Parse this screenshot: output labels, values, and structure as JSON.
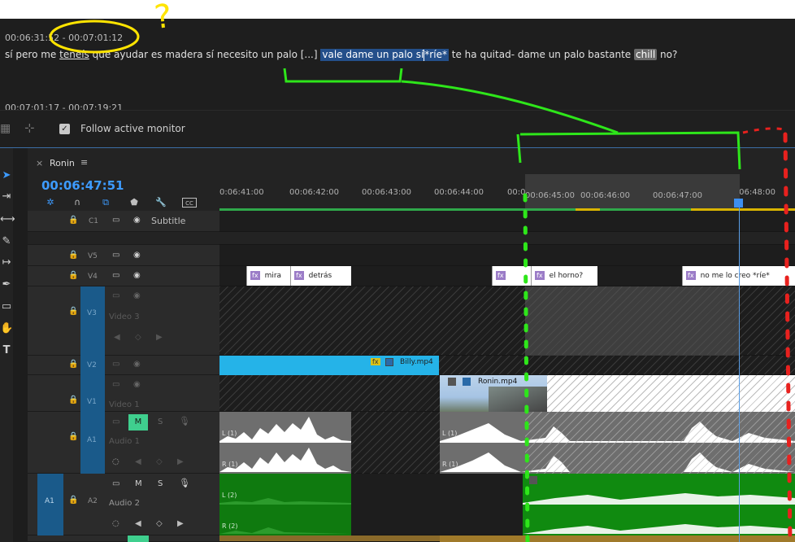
{
  "transcript": {
    "ts1": "00:06:31:52 - 00:07:01:12",
    "ts2": "00:07:01:17 - 00:07:19:21",
    "line": {
      "seg1": "sí pero me",
      "seg2": "teneís",
      "seg3": "que ayudar es madera sí necesito un palo [...]",
      "highlight": "vale dame un palo sí",
      "highlight2": "*ríe*",
      "seg4": "te ha quitad- dame un palo bastante",
      "chill": "chill",
      "seg5": "no?"
    }
  },
  "toolbar": {
    "follow_label": "Follow active monitor",
    "follow_checked": "✓"
  },
  "sequence": {
    "tab_close": "×",
    "title": "Ronin",
    "menu": "≡",
    "timecode": "00:06:47:51"
  },
  "ruler": {
    "ticks": [
      "0:06:41:00",
      "00:06:42:00",
      "00:06:43:00",
      "00:06:44:00",
      "00:06:45:00",
      "00:06:46:00",
      "00:06:47:00",
      "00:06:48:00"
    ]
  },
  "tracks": {
    "c1": {
      "label": "C1",
      "name": "Subtitle"
    },
    "v5": {
      "label": "V5"
    },
    "v4": {
      "label": "V4"
    },
    "v3": {
      "label": "V3",
      "name": "Video 3"
    },
    "v2": {
      "label": "V2"
    },
    "v1": {
      "label": "V1",
      "name": "Video 1"
    },
    "a1": {
      "label": "A1",
      "name": "Audio 1",
      "m": "M",
      "s": "S"
    },
    "a2": {
      "label": "A2",
      "name": "Audio 2",
      "src": "A1",
      "m": "M",
      "s": "S"
    }
  },
  "clips": {
    "subs": [
      {
        "fx": "fx",
        "text": "mira"
      },
      {
        "fx": "fx",
        "text": "detrás"
      },
      {
        "fx": "fx",
        "text": ""
      },
      {
        "fx": "fx",
        "text": "el horno?"
      },
      {
        "fx": "fx",
        "text": "no me lo creo *ríe*"
      }
    ],
    "billy": "Billy.mp4",
    "ronin": "Ronin.mp4",
    "audio_labels": {
      "l1": "L (1)",
      "r1": "R (1)",
      "l2": "L (2)",
      "r2": "R (2)"
    }
  },
  "annotations": {
    "question": "?"
  },
  "colors": {
    "accent": "#3d9bff",
    "subtitle_clip": "#ffffff",
    "video_clip": "#25b3e8",
    "audio_green": "#0f8a0f",
    "annotation_yellow": "#ffe400",
    "annotation_green": "#2ee61a",
    "annotation_red": "#e8211e"
  }
}
